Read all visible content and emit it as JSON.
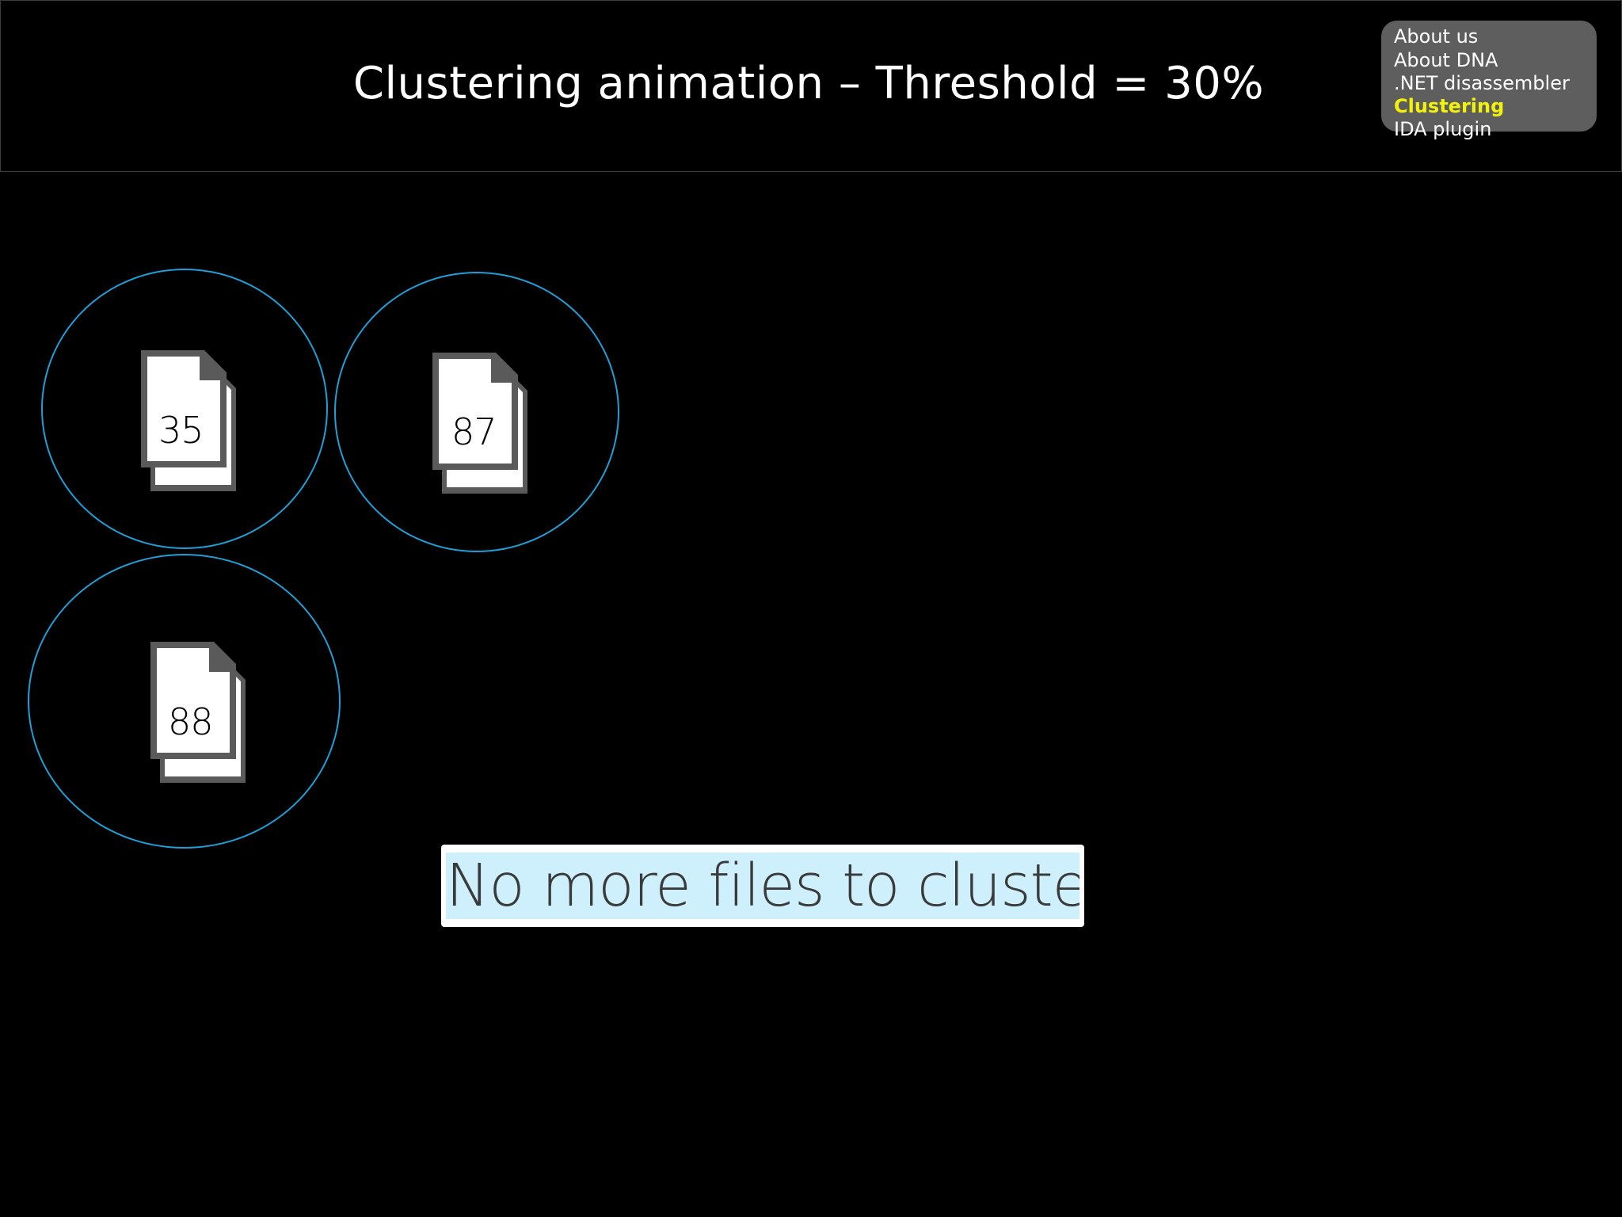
{
  "header": {
    "title": "Clustering animation – Threshold = 30%"
  },
  "nav": {
    "items": [
      {
        "label": "About us",
        "active": false
      },
      {
        "label": "About DNA",
        "active": false
      },
      {
        "label": ".NET disassembler",
        "active": false
      },
      {
        "label": "Clustering",
        "active": true
      },
      {
        "label": "IDA plugin",
        "active": false
      }
    ],
    "active_color": "#f2f20a",
    "background_color": "#5e5e5e"
  },
  "clusters": [
    {
      "file_label": "35"
    },
    {
      "file_label": "87"
    },
    {
      "file_label": "88"
    }
  ],
  "cluster_color": "#1e9fd8",
  "message": {
    "text": "No more files to cluster!",
    "background_color": "#cdf0fc"
  }
}
